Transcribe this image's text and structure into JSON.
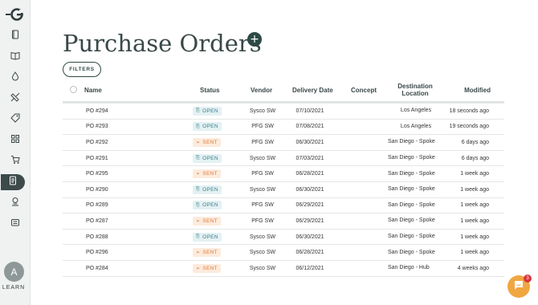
{
  "app": {
    "logo_icon": "g-logo-icon"
  },
  "sidebar": {
    "items": [
      {
        "icon": "document-icon",
        "active": false
      },
      {
        "icon": "book-icon",
        "active": false
      },
      {
        "icon": "drop-icon",
        "active": false
      },
      {
        "icon": "ingredients-icon",
        "active": false
      },
      {
        "icon": "tag-icon",
        "active": false
      },
      {
        "icon": "inventory-icon",
        "active": false
      },
      {
        "icon": "cart-icon",
        "active": false
      },
      {
        "icon": "purchase-orders-icon",
        "active": true
      },
      {
        "icon": "vendor-icon",
        "active": false
      },
      {
        "icon": "reports-icon",
        "active": false
      }
    ],
    "avatar_initial": "A",
    "learn_label": "LEARN"
  },
  "page": {
    "title": "Purchase Orders",
    "add_label": "+",
    "filters_label": "FILTERS"
  },
  "table": {
    "columns": {
      "name": "Name",
      "status": "Status",
      "vendor": "Vendor",
      "delivery_date": "Delivery Date",
      "concept": "Concept",
      "destination": "Destination Location",
      "modified": "Modified"
    },
    "rows": [
      {
        "name": "PO #294",
        "status": "OPEN",
        "vendor": "Sysco SW",
        "delivery_date": "07/10/2021",
        "concept": "",
        "destination": "Los Angeles",
        "modified": "18 seconds ago"
      },
      {
        "name": "PO #293",
        "status": "OPEN",
        "vendor": "PFG SW",
        "delivery_date": "07/08/2021",
        "concept": "",
        "destination": "Los Angeles",
        "modified": "19 seconds ago"
      },
      {
        "name": "PO #292",
        "status": "SENT",
        "vendor": "PFG SW",
        "delivery_date": "06/30/2021",
        "concept": "",
        "destination": "San Diego - Spoke",
        "modified": "6 days ago"
      },
      {
        "name": "PO #291",
        "status": "OPEN",
        "vendor": "Sysco SW",
        "delivery_date": "07/03/2021",
        "concept": "",
        "destination": "San Diego - Spoke",
        "modified": "6 days ago"
      },
      {
        "name": "PO #295",
        "status": "SENT",
        "vendor": "PFG SW",
        "delivery_date": "06/28/2021",
        "concept": "",
        "destination": "San Diego - Spoke",
        "modified": "1 week ago"
      },
      {
        "name": "PO #290",
        "status": "OPEN",
        "vendor": "Sysco SW",
        "delivery_date": "06/30/2021",
        "concept": "",
        "destination": "San Diego - Spoke",
        "modified": "1 week ago"
      },
      {
        "name": "PO #289",
        "status": "OPEN",
        "vendor": "PFG SW",
        "delivery_date": "06/29/2021",
        "concept": "",
        "destination": "San Diego - Spoke",
        "modified": "1 week ago"
      },
      {
        "name": "PO #287",
        "status": "SENT",
        "vendor": "PFG SW",
        "delivery_date": "06/29/2021",
        "concept": "",
        "destination": "San Diego - Spoke",
        "modified": "1 week ago"
      },
      {
        "name": "PO #288",
        "status": "OPEN",
        "vendor": "Sysco SW",
        "delivery_date": "06/30/2021",
        "concept": "",
        "destination": "San Diego - Spoke",
        "modified": "1 week ago"
      },
      {
        "name": "PO #296",
        "status": "SENT",
        "vendor": "Sysco SW",
        "delivery_date": "06/28/2021",
        "concept": "",
        "destination": "San Diego - Spoke",
        "modified": "1 week ago"
      },
      {
        "name": "PO #284",
        "status": "SENT",
        "vendor": "Sysco SW",
        "delivery_date": "06/12/2021",
        "concept": "",
        "destination": "San Diego - Hub",
        "modified": "4 weeks ago"
      }
    ]
  },
  "chat": {
    "icon": "chat-icon",
    "unread_count": "3"
  },
  "colors": {
    "accent": "#2e4a46",
    "sidebar_bg": "#f0f1f1",
    "sidebar_active": "#3d4a4a",
    "open_badge_bg": "#e3f1f3",
    "open_badge_text": "#3b7f8a",
    "sent_badge_bg": "#fdebdc",
    "sent_badge_text": "#e07a3a",
    "chat_bg": "#f0a742",
    "notification": "#d9363e"
  }
}
